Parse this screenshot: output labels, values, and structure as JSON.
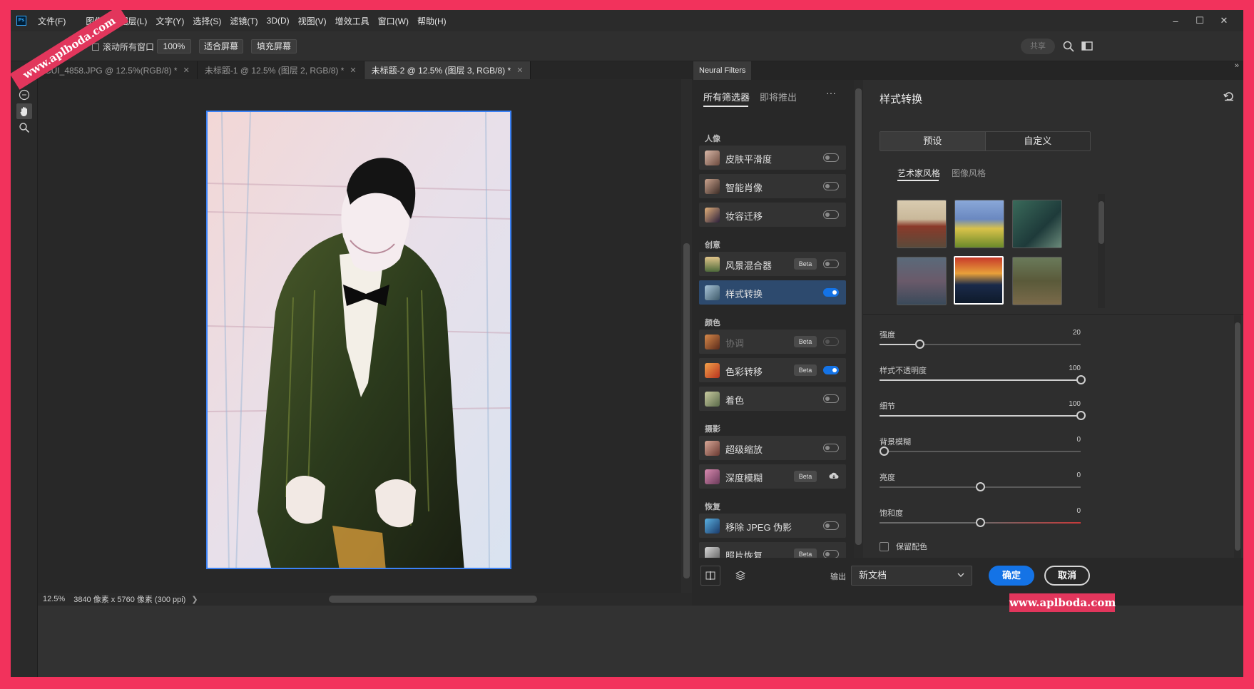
{
  "app": {
    "logo_text": "Ps"
  },
  "menu": [
    "文件(F)",
    "图像(I)",
    "图层(L)",
    "文字(Y)",
    "选择(S)",
    "滤镜(T)",
    "3D(D)",
    "视图(V)",
    "增效工具",
    "窗口(W)",
    "帮助(H)"
  ],
  "window_controls": {
    "minimize": "–",
    "maximize": "☐",
    "close": "✕"
  },
  "options": {
    "scroll_all_label": "滚动所有窗口",
    "zoom_value": "100%",
    "fit_screen": "适合屏幕",
    "fill_screen": "填充屏幕",
    "share": "共享"
  },
  "doc_tabs": [
    {
      "title": "CUI_4858.JPG @ 12.5%(RGB/8) *",
      "active": false
    },
    {
      "title": "未标题-1 @ 12.5% (图层 2, RGB/8) *",
      "active": false
    },
    {
      "title": "未标题-2 @ 12.5% (图层 3, RGB/8) *",
      "active": true
    }
  ],
  "status": {
    "zoom": "12.5%",
    "info": "3840 像素 x 5760 像素 (300 ppi)"
  },
  "neural_filters": {
    "panel_tab": "Neural Filters",
    "tab_all": "所有筛选器",
    "tab_upcoming": "即将推出",
    "more": "···",
    "groups": {
      "portrait": "人像",
      "creative": "创意",
      "color": "颜色",
      "photo": "摄影",
      "restore": "恢复"
    },
    "filters": {
      "skin": {
        "label": "皮肤平滑度"
      },
      "smart_portrait": {
        "label": "智能肖像"
      },
      "makeup": {
        "label": "妆容迁移"
      },
      "landscape": {
        "label": "风景混合器",
        "badge": "Beta"
      },
      "style_transfer": {
        "label": "样式转换"
      },
      "harmonize": {
        "label": "协调",
        "badge": "Beta"
      },
      "color_transfer": {
        "label": "色彩转移",
        "badge": "Beta"
      },
      "colorize": {
        "label": "着色"
      },
      "super_zoom": {
        "label": "超级缩放"
      },
      "depth_blur": {
        "label": "深度模糊",
        "badge": "Beta"
      },
      "jpeg": {
        "label": "移除 JPEG 伪影"
      },
      "photo_restore": {
        "label": "照片恢复",
        "badge": "Beta"
      }
    }
  },
  "style_panel": {
    "title": "样式转换",
    "seg_presets": "预设",
    "seg_custom": "自定义",
    "sub_artist": "艺术家风格",
    "sub_image": "图像风格",
    "sliders": {
      "strength": {
        "label": "强度",
        "value": "20"
      },
      "opacity": {
        "label": "样式不透明度",
        "value": "100"
      },
      "detail": {
        "label": "细节",
        "value": "100"
      },
      "bg_blur": {
        "label": "背景模糊",
        "value": "0"
      },
      "brightness": {
        "label": "亮度",
        "value": "0"
      },
      "saturation": {
        "label": "饱和度",
        "value": "0"
      }
    },
    "preserve_color": "保留配色"
  },
  "bottom": {
    "output_label": "输出",
    "output_value": "新文档",
    "ok": "确定",
    "cancel": "取消"
  },
  "watermark": "www.aplboda.com",
  "colors": {
    "accent": "#1473e6",
    "frame": "#f2325c",
    "selection": "#2d4a6e"
  }
}
